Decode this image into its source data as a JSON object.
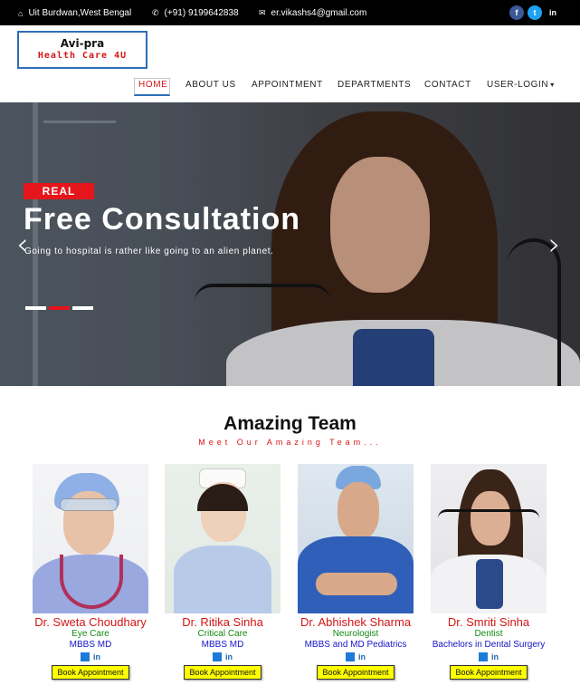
{
  "topbar": {
    "address": "Uit Burdwan,West Bengal",
    "phone": "(+91) 9199642838",
    "email": "er.vikashs4@gmail.com",
    "social": [
      "f",
      "t",
      "in"
    ]
  },
  "brand": {
    "line1": "Avi-pra",
    "line2": "Health Care 4U"
  },
  "nav": {
    "home": "HOME",
    "about": "ABOUT US",
    "appointment": "APPOINTMENT",
    "departments": "DEPARTMENTS",
    "contact": "CONTACT",
    "login": "USER-LOGIN"
  },
  "hero": {
    "tag": "REAL",
    "title": "Free Consultation",
    "subtitle": "Going to hospital is rather like going to an alien planet.",
    "prev": "‹",
    "next": "›"
  },
  "team": {
    "title": "Amazing Team",
    "subtitle": "Meet Our Amazing Team...",
    "book_label": "Book Appointment",
    "linkedin": "in",
    "doctors": [
      {
        "name": "Dr. Sweta Choudhary",
        "specialty": "Eye Care",
        "qualification": "MBBS MD"
      },
      {
        "name": "Dr. Ritika Sinha",
        "specialty": "Critical Care",
        "qualification": "MBBS MD"
      },
      {
        "name": "Dr. Abhishek Sharma",
        "specialty": "Neurologist",
        "qualification": "MBBS and MD Pediatrics"
      },
      {
        "name": "Dr. Smriti Sinha",
        "specialty": "Dentist",
        "qualification": "Bachelors in Dental Surgery"
      }
    ]
  },
  "colors": {
    "accent": "#d51515",
    "brand_blue": "#2d6fb7",
    "button": "#ffff00"
  }
}
